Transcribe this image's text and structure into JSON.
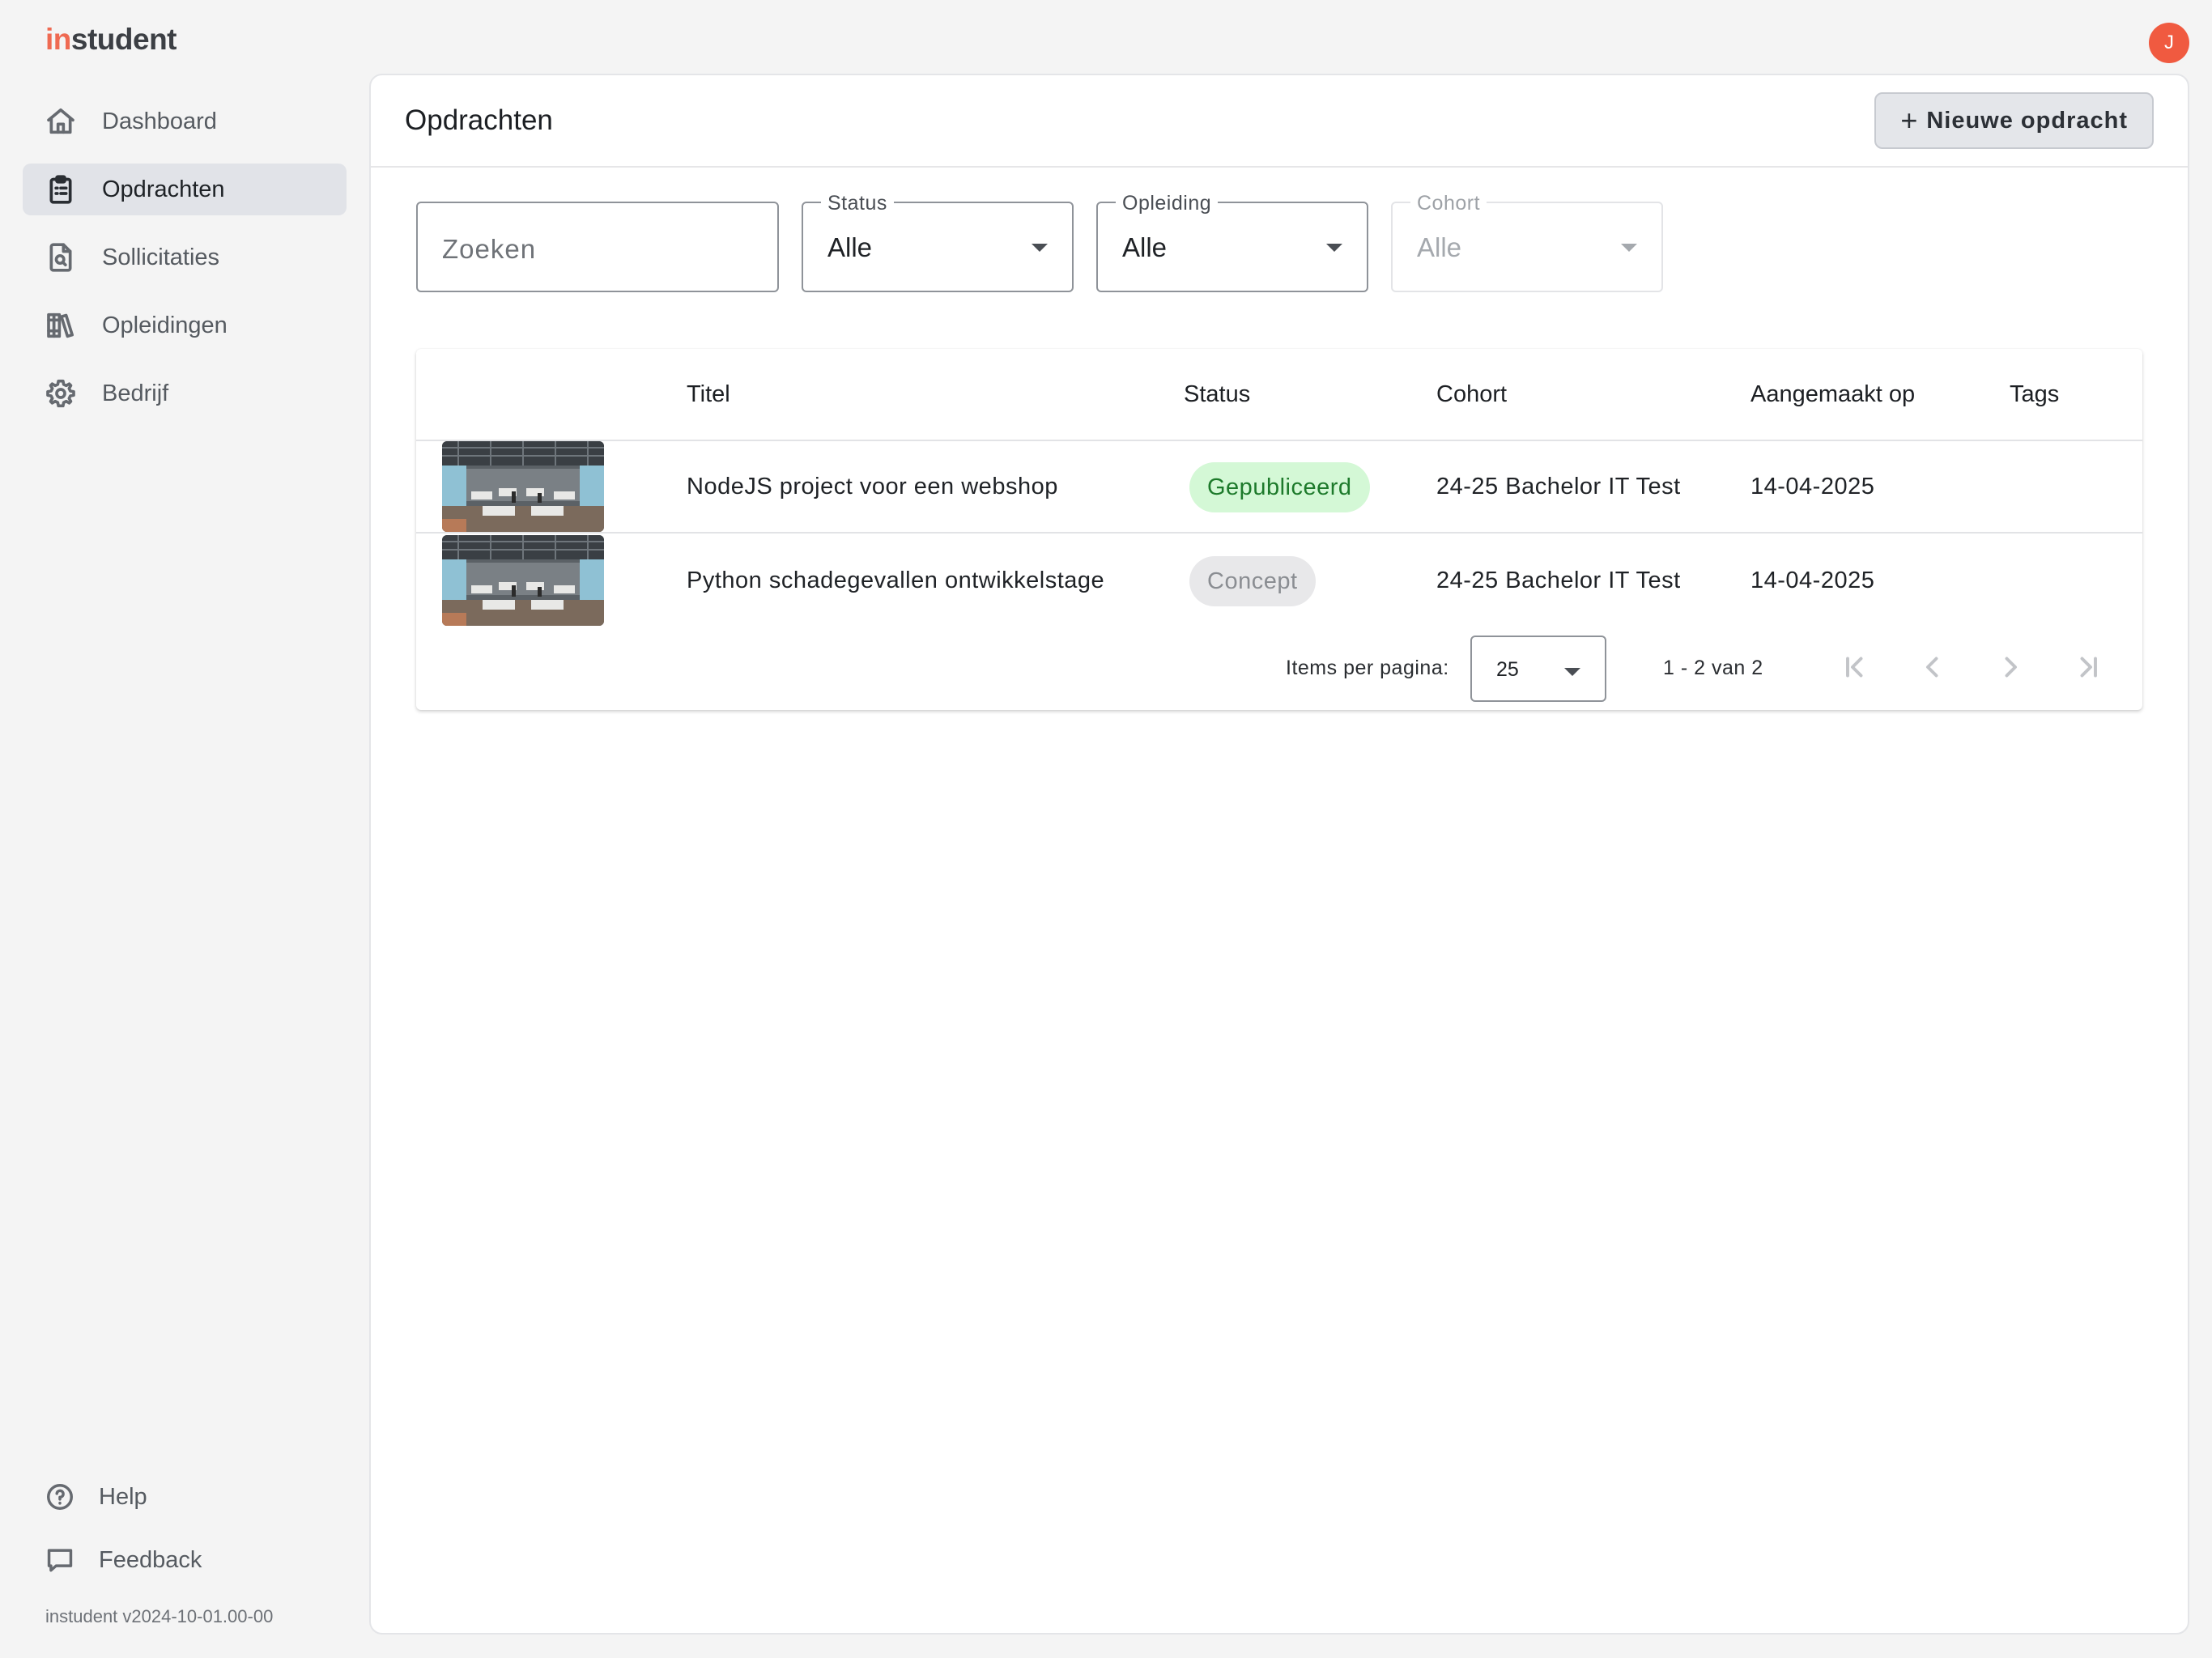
{
  "app": {
    "logo_accent": "in",
    "logo_rest": "student",
    "avatar_initial": "J",
    "version": "instudent v2024-10-01.00-00"
  },
  "sidebar": {
    "items": [
      {
        "label": "Dashboard",
        "icon": "home-icon",
        "active": false
      },
      {
        "label": "Opdrachten",
        "icon": "clipboard-icon",
        "active": true
      },
      {
        "label": "Sollicitaties",
        "icon": "document-search-icon",
        "active": false
      },
      {
        "label": "Opleidingen",
        "icon": "library-icon",
        "active": false
      },
      {
        "label": "Bedrijf",
        "icon": "gear-icon",
        "active": false
      }
    ],
    "bottom": [
      {
        "label": "Help",
        "icon": "help-circle-icon"
      },
      {
        "label": "Feedback",
        "icon": "chat-bubble-icon"
      }
    ]
  },
  "page": {
    "title": "Opdrachten",
    "new_button_label": "Nieuwe opdracht"
  },
  "filters": {
    "search_placeholder": "Zoeken",
    "status": {
      "label": "Status",
      "value": "Alle"
    },
    "opleiding": {
      "label": "Opleiding",
      "value": "Alle"
    },
    "cohort": {
      "label": "Cohort",
      "value": "Alle",
      "disabled": true
    }
  },
  "table": {
    "headers": [
      "Titel",
      "Status",
      "Cohort",
      "Aangemaakt op",
      "Tags"
    ],
    "rows": [
      {
        "title": "NodeJS project voor een webshop",
        "status": "Gepubliceerd",
        "cohort": "24-25 Bachelor IT Test",
        "created": "14-04-2025",
        "tags": ""
      },
      {
        "title": "Python schadegevallen ontwikkelstage",
        "status": "Concept",
        "cohort": "24-25 Bachelor IT Test",
        "created": "14-04-2025",
        "tags": ""
      }
    ]
  },
  "pagination": {
    "items_per_page_label": "Items per pagina:",
    "items_per_page": "25",
    "range": "1 - 2 van 2"
  },
  "colors": {
    "brand_accent": "#ef6a52",
    "avatar": "#f05a40",
    "published_bg": "#d4f8d6",
    "published_text": "#1d7a2b",
    "concept_bg": "#e8e8ea"
  }
}
